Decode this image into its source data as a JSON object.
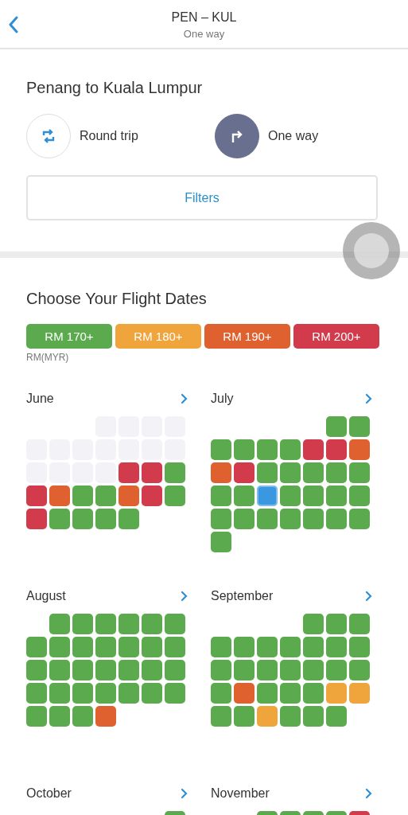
{
  "header": {
    "title": "PEN – KUL",
    "subtitle": "One way"
  },
  "route": {
    "title": "Penang to Kuala Lumpur"
  },
  "trip_types": [
    {
      "kind": "round",
      "label": "Round trip",
      "selected": false
    },
    {
      "kind": "oneway",
      "label": "One way",
      "selected": true
    }
  ],
  "filters_button": "Filters",
  "calendar": {
    "title": "Choose Your Flight Dates",
    "legend": [
      {
        "label": "RM 170+",
        "color": "#5caa4e"
      },
      {
        "label": "RM 180+",
        "color": "#f0a43c"
      },
      {
        "label": "RM 190+",
        "color": "#df6130"
      },
      {
        "label": "RM 200+",
        "color": "#d13b4b"
      }
    ],
    "currency": "RM(MYR)",
    "months": [
      {
        "name": "June",
        "days": [
          {
            "kind": "blank"
          },
          {
            "kind": "blank"
          },
          {
            "kind": "blank"
          },
          {
            "kind": "past"
          },
          {
            "kind": "past"
          },
          {
            "kind": "past"
          },
          {
            "kind": "past"
          },
          {
            "kind": "past"
          },
          {
            "kind": "past"
          },
          {
            "kind": "past"
          },
          {
            "kind": "past"
          },
          {
            "kind": "past"
          },
          {
            "kind": "past"
          },
          {
            "kind": "past"
          },
          {
            "kind": "past"
          },
          {
            "kind": "past"
          },
          {
            "kind": "past"
          },
          {
            "kind": "past"
          },
          {
            "kind": "price",
            "color": "#d13b4b",
            "selected": false
          },
          {
            "kind": "price",
            "color": "#d13b4b",
            "selected": false
          },
          {
            "kind": "price",
            "color": "#5caa4e",
            "selected": false
          },
          {
            "kind": "price",
            "color": "#d13b4b",
            "selected": false
          },
          {
            "kind": "price",
            "color": "#df6130",
            "selected": false
          },
          {
            "kind": "price",
            "color": "#5caa4e",
            "selected": false
          },
          {
            "kind": "price",
            "color": "#5caa4e",
            "selected": false
          },
          {
            "kind": "price",
            "color": "#df6130",
            "selected": false
          },
          {
            "kind": "price",
            "color": "#d13b4b",
            "selected": false
          },
          {
            "kind": "price",
            "color": "#5caa4e",
            "selected": false
          },
          {
            "kind": "price",
            "color": "#d13b4b",
            "selected": false
          },
          {
            "kind": "price",
            "color": "#5caa4e",
            "selected": false
          },
          {
            "kind": "price",
            "color": "#5caa4e",
            "selected": false
          },
          {
            "kind": "price",
            "color": "#5caa4e",
            "selected": false
          },
          {
            "kind": "price",
            "color": "#5caa4e",
            "selected": false
          }
        ]
      },
      {
        "name": "July",
        "days": [
          {
            "kind": "blank"
          },
          {
            "kind": "blank"
          },
          {
            "kind": "blank"
          },
          {
            "kind": "blank"
          },
          {
            "kind": "blank"
          },
          {
            "kind": "price",
            "color": "#5caa4e",
            "selected": false
          },
          {
            "kind": "price",
            "color": "#5caa4e",
            "selected": false
          },
          {
            "kind": "price",
            "color": "#5caa4e",
            "selected": false
          },
          {
            "kind": "price",
            "color": "#5caa4e",
            "selected": false
          },
          {
            "kind": "price",
            "color": "#5caa4e",
            "selected": false
          },
          {
            "kind": "price",
            "color": "#5caa4e",
            "selected": false
          },
          {
            "kind": "price",
            "color": "#d13b4b",
            "selected": false
          },
          {
            "kind": "price",
            "color": "#d13b4b",
            "selected": false
          },
          {
            "kind": "price",
            "color": "#df6130",
            "selected": false
          },
          {
            "kind": "price",
            "color": "#df6130",
            "selected": false
          },
          {
            "kind": "price",
            "color": "#d13b4b",
            "selected": false
          },
          {
            "kind": "price",
            "color": "#5caa4e",
            "selected": false
          },
          {
            "kind": "price",
            "color": "#5caa4e",
            "selected": false
          },
          {
            "kind": "price",
            "color": "#5caa4e",
            "selected": false
          },
          {
            "kind": "price",
            "color": "#5caa4e",
            "selected": false
          },
          {
            "kind": "price",
            "color": "#5caa4e",
            "selected": false
          },
          {
            "kind": "price",
            "color": "#5caa4e",
            "selected": false
          },
          {
            "kind": "price",
            "color": "#5caa4e",
            "selected": false
          },
          {
            "kind": "price",
            "color": "#3b98e0",
            "selected": true
          },
          {
            "kind": "price",
            "color": "#5caa4e",
            "selected": false
          },
          {
            "kind": "price",
            "color": "#5caa4e",
            "selected": false
          },
          {
            "kind": "price",
            "color": "#5caa4e",
            "selected": false
          },
          {
            "kind": "price",
            "color": "#5caa4e",
            "selected": false
          },
          {
            "kind": "price",
            "color": "#5caa4e",
            "selected": false
          },
          {
            "kind": "price",
            "color": "#5caa4e",
            "selected": false
          },
          {
            "kind": "price",
            "color": "#5caa4e",
            "selected": false
          },
          {
            "kind": "price",
            "color": "#5caa4e",
            "selected": false
          },
          {
            "kind": "price",
            "color": "#5caa4e",
            "selected": false
          },
          {
            "kind": "price",
            "color": "#5caa4e",
            "selected": false
          },
          {
            "kind": "price",
            "color": "#5caa4e",
            "selected": false
          },
          {
            "kind": "price",
            "color": "#5caa4e",
            "selected": false
          }
        ]
      },
      {
        "name": "August",
        "days": [
          {
            "kind": "blank"
          },
          {
            "kind": "price",
            "color": "#5caa4e",
            "selected": false
          },
          {
            "kind": "price",
            "color": "#5caa4e",
            "selected": false
          },
          {
            "kind": "price",
            "color": "#5caa4e",
            "selected": false
          },
          {
            "kind": "price",
            "color": "#5caa4e",
            "selected": false
          },
          {
            "kind": "price",
            "color": "#5caa4e",
            "selected": false
          },
          {
            "kind": "price",
            "color": "#5caa4e",
            "selected": false
          },
          {
            "kind": "price",
            "color": "#5caa4e",
            "selected": false
          },
          {
            "kind": "price",
            "color": "#5caa4e",
            "selected": false
          },
          {
            "kind": "price",
            "color": "#5caa4e",
            "selected": false
          },
          {
            "kind": "price",
            "color": "#5caa4e",
            "selected": false
          },
          {
            "kind": "price",
            "color": "#5caa4e",
            "selected": false
          },
          {
            "kind": "price",
            "color": "#5caa4e",
            "selected": false
          },
          {
            "kind": "price",
            "color": "#5caa4e",
            "selected": false
          },
          {
            "kind": "price",
            "color": "#5caa4e",
            "selected": false
          },
          {
            "kind": "price",
            "color": "#5caa4e",
            "selected": false
          },
          {
            "kind": "price",
            "color": "#5caa4e",
            "selected": false
          },
          {
            "kind": "price",
            "color": "#5caa4e",
            "selected": false
          },
          {
            "kind": "price",
            "color": "#5caa4e",
            "selected": false
          },
          {
            "kind": "price",
            "color": "#5caa4e",
            "selected": false
          },
          {
            "kind": "price",
            "color": "#5caa4e",
            "selected": false
          },
          {
            "kind": "price",
            "color": "#5caa4e",
            "selected": false
          },
          {
            "kind": "price",
            "color": "#5caa4e",
            "selected": false
          },
          {
            "kind": "price",
            "color": "#5caa4e",
            "selected": false
          },
          {
            "kind": "price",
            "color": "#5caa4e",
            "selected": false
          },
          {
            "kind": "price",
            "color": "#5caa4e",
            "selected": false
          },
          {
            "kind": "price",
            "color": "#5caa4e",
            "selected": false
          },
          {
            "kind": "price",
            "color": "#5caa4e",
            "selected": false
          },
          {
            "kind": "price",
            "color": "#5caa4e",
            "selected": false
          },
          {
            "kind": "price",
            "color": "#5caa4e",
            "selected": false
          },
          {
            "kind": "price",
            "color": "#5caa4e",
            "selected": false
          },
          {
            "kind": "price",
            "color": "#df6130",
            "selected": false
          }
        ]
      },
      {
        "name": "September",
        "days": [
          {
            "kind": "blank"
          },
          {
            "kind": "blank"
          },
          {
            "kind": "blank"
          },
          {
            "kind": "blank"
          },
          {
            "kind": "price",
            "color": "#5caa4e",
            "selected": false
          },
          {
            "kind": "price",
            "color": "#5caa4e",
            "selected": false
          },
          {
            "kind": "price",
            "color": "#5caa4e",
            "selected": false
          },
          {
            "kind": "price",
            "color": "#5caa4e",
            "selected": false
          },
          {
            "kind": "price",
            "color": "#5caa4e",
            "selected": false
          },
          {
            "kind": "price",
            "color": "#5caa4e",
            "selected": false
          },
          {
            "kind": "price",
            "color": "#5caa4e",
            "selected": false
          },
          {
            "kind": "price",
            "color": "#5caa4e",
            "selected": false
          },
          {
            "kind": "price",
            "color": "#5caa4e",
            "selected": false
          },
          {
            "kind": "price",
            "color": "#5caa4e",
            "selected": false
          },
          {
            "kind": "price",
            "color": "#5caa4e",
            "selected": false
          },
          {
            "kind": "price",
            "color": "#5caa4e",
            "selected": false
          },
          {
            "kind": "price",
            "color": "#5caa4e",
            "selected": false
          },
          {
            "kind": "price",
            "color": "#5caa4e",
            "selected": false
          },
          {
            "kind": "price",
            "color": "#5caa4e",
            "selected": false
          },
          {
            "kind": "price",
            "color": "#5caa4e",
            "selected": false
          },
          {
            "kind": "price",
            "color": "#5caa4e",
            "selected": false
          },
          {
            "kind": "price",
            "color": "#5caa4e",
            "selected": false
          },
          {
            "kind": "price",
            "color": "#df6130",
            "selected": false
          },
          {
            "kind": "price",
            "color": "#5caa4e",
            "selected": false
          },
          {
            "kind": "price",
            "color": "#5caa4e",
            "selected": false
          },
          {
            "kind": "price",
            "color": "#5caa4e",
            "selected": false
          },
          {
            "kind": "price",
            "color": "#f0a43c",
            "selected": false
          },
          {
            "kind": "price",
            "color": "#f0a43c",
            "selected": false
          },
          {
            "kind": "price",
            "color": "#5caa4e",
            "selected": false
          },
          {
            "kind": "price",
            "color": "#5caa4e",
            "selected": false
          },
          {
            "kind": "price",
            "color": "#f0a43c",
            "selected": false
          },
          {
            "kind": "price",
            "color": "#5caa4e",
            "selected": false
          },
          {
            "kind": "price",
            "color": "#5caa4e",
            "selected": false
          },
          {
            "kind": "price",
            "color": "#5caa4e",
            "selected": false
          }
        ]
      },
      {
        "name": "October",
        "days": [
          {
            "kind": "blank"
          },
          {
            "kind": "blank"
          },
          {
            "kind": "blank"
          },
          {
            "kind": "blank"
          },
          {
            "kind": "blank"
          },
          {
            "kind": "blank"
          },
          {
            "kind": "price",
            "color": "#5caa4e",
            "selected": false
          }
        ]
      },
      {
        "name": "November",
        "days": [
          {
            "kind": "blank"
          },
          {
            "kind": "blank"
          },
          {
            "kind": "price",
            "color": "#5caa4e",
            "selected": false
          },
          {
            "kind": "price",
            "color": "#5caa4e",
            "selected": false
          },
          {
            "kind": "price",
            "color": "#5caa4e",
            "selected": false
          },
          {
            "kind": "price",
            "color": "#5caa4e",
            "selected": false
          },
          {
            "kind": "price",
            "color": "#d13b4b",
            "selected": false
          }
        ]
      }
    ]
  }
}
